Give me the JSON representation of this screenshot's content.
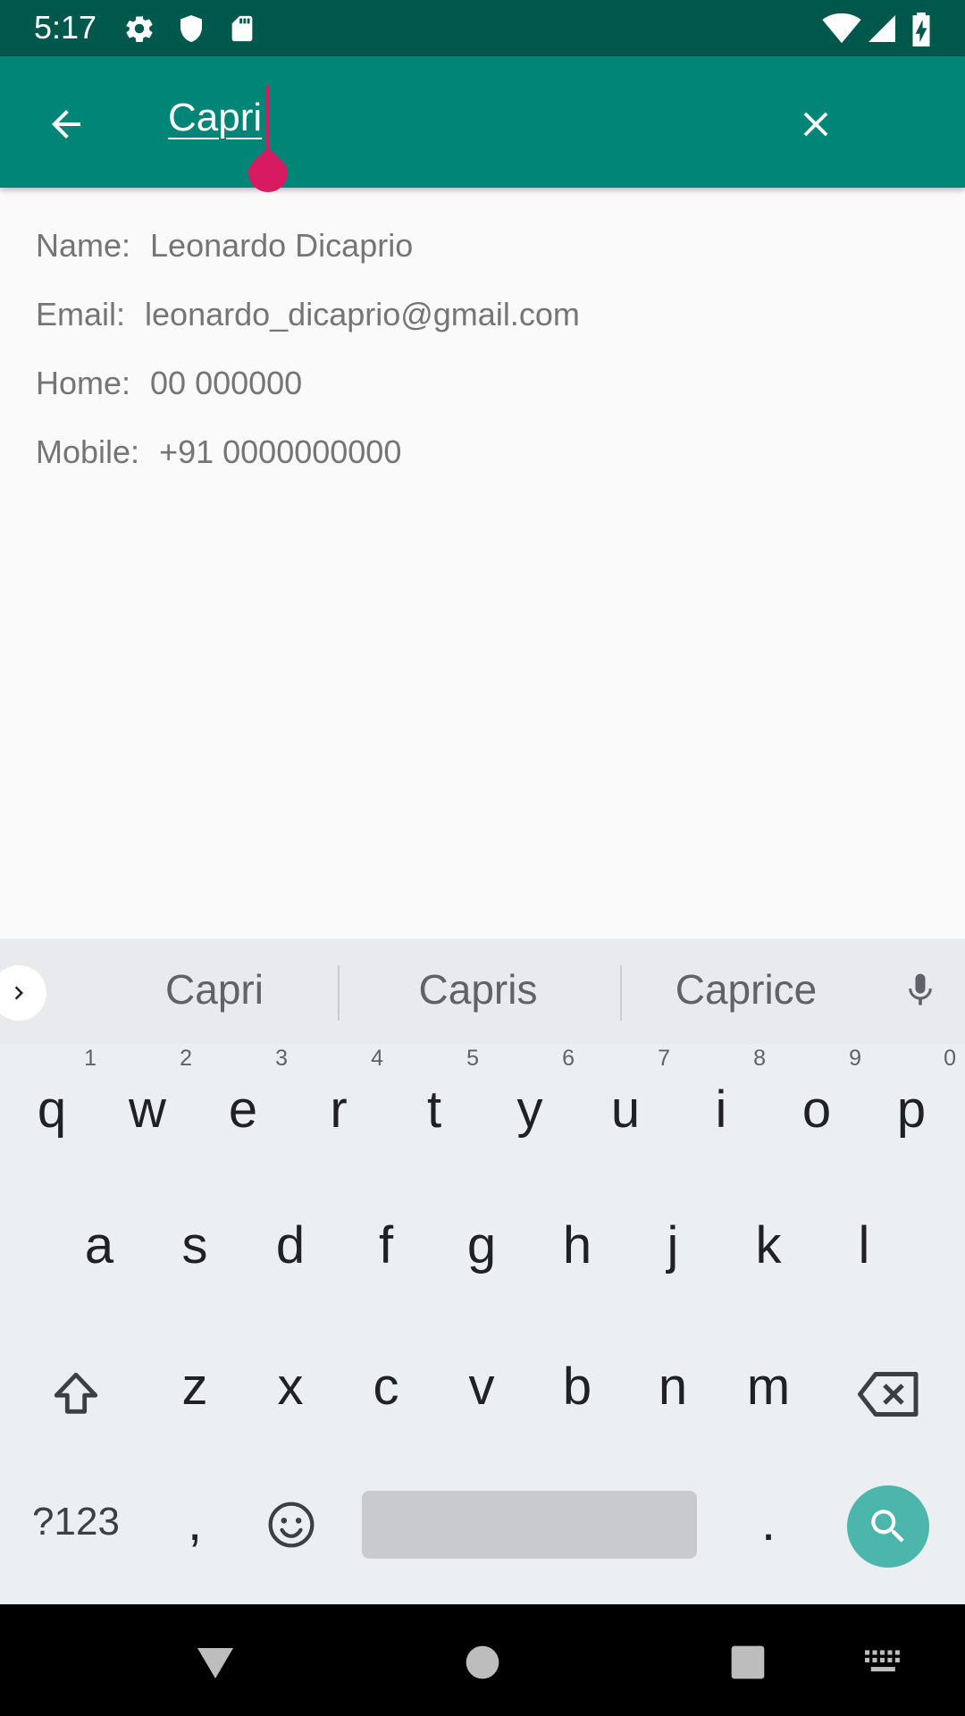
{
  "status_bar": {
    "time": "5:17"
  },
  "search": {
    "query": "Capri"
  },
  "contact": {
    "name_label": "Name:",
    "name_value": "Leonardo Dicaprio",
    "email_label": "Email:",
    "email_value": "leonardo_dicaprio@gmail.com",
    "home_label": "Home:",
    "home_value": "00 000000",
    "mobile_label": "Mobile:",
    "mobile_value": "+91 0000000000"
  },
  "keyboard": {
    "suggestions": [
      "Capri",
      "Capris",
      "Caprice"
    ],
    "row1": [
      "q",
      "w",
      "e",
      "r",
      "t",
      "y",
      "u",
      "i",
      "o",
      "p"
    ],
    "row1_hints": [
      "1",
      "2",
      "3",
      "4",
      "5",
      "6",
      "7",
      "8",
      "9",
      "0"
    ],
    "row2": [
      "a",
      "s",
      "d",
      "f",
      "g",
      "h",
      "j",
      "k",
      "l"
    ],
    "row3": [
      "z",
      "x",
      "c",
      "v",
      "b",
      "n",
      "m"
    ],
    "symbols_label": "?123",
    "comma": ",",
    "period": "."
  },
  "colors": {
    "status_bar": "#00574b",
    "app_bar": "#008577",
    "accent": "#d81b60",
    "action_key": "#4db6ac"
  }
}
